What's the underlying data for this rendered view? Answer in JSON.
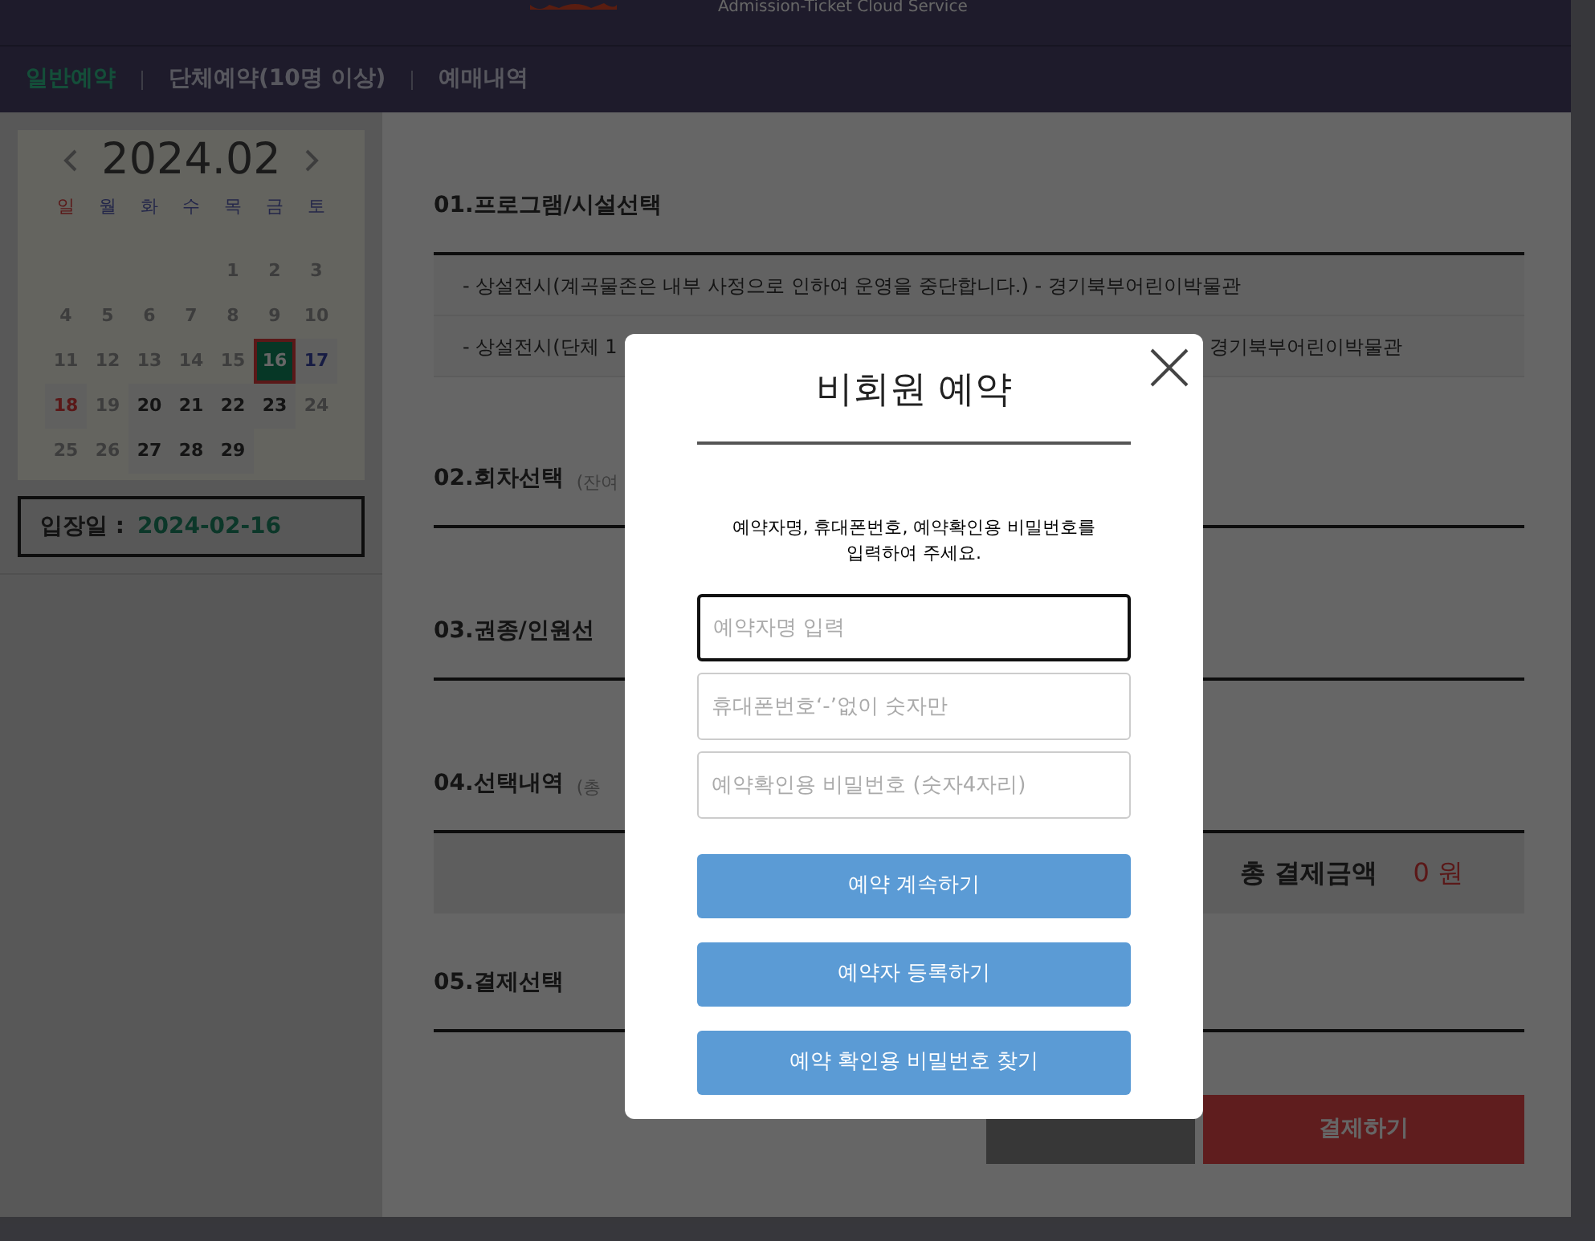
{
  "header": {
    "tagline": "Admission-Ticket Cloud Service"
  },
  "nav": [
    {
      "label": "일반예약",
      "selected": true
    },
    {
      "label": "단체예약(10명 이상)",
      "selected": false
    },
    {
      "label": "예매내역",
      "selected": false
    }
  ],
  "calendar": {
    "title": "2024.02",
    "weekdays": [
      "일",
      "월",
      "화",
      "수",
      "목",
      "금",
      "토"
    ],
    "weeks": [
      [
        {
          "day": "1",
          "available": false,
          "selected": false
        },
        {
          "day": "2",
          "available": false,
          "selected": false
        },
        {
          "day": "3",
          "available": false,
          "selected": false
        }
      ],
      [
        {
          "day": "4",
          "available": false,
          "selected": false
        },
        {
          "day": "5",
          "available": false,
          "selected": false
        },
        {
          "day": "6",
          "available": false,
          "selected": false
        },
        {
          "day": "7",
          "available": false,
          "selected": false
        },
        {
          "day": "8",
          "available": false,
          "selected": false
        },
        {
          "day": "9",
          "available": false,
          "selected": false
        },
        {
          "day": "10",
          "available": false,
          "selected": false
        }
      ],
      [
        {
          "day": "11",
          "available": false,
          "selected": false
        },
        {
          "day": "12",
          "available": false,
          "selected": false
        },
        {
          "day": "13",
          "available": false,
          "selected": false
        },
        {
          "day": "14",
          "available": false,
          "selected": false
        },
        {
          "day": "15",
          "available": false,
          "selected": false
        },
        {
          "day": "16",
          "available": true,
          "selected": true
        },
        {
          "day": "17",
          "available": true,
          "selected": false
        }
      ],
      [
        {
          "day": "18",
          "available": true,
          "selected": false
        },
        {
          "day": "19",
          "available": false,
          "selected": false
        },
        {
          "day": "20",
          "available": true,
          "selected": false
        },
        {
          "day": "21",
          "available": true,
          "selected": false
        },
        {
          "day": "22",
          "available": true,
          "selected": false
        },
        {
          "day": "23",
          "available": true,
          "selected": false
        },
        {
          "day": "24",
          "available": false,
          "selected": false
        }
      ],
      [
        {
          "day": "25",
          "available": false,
          "selected": false
        },
        {
          "day": "26",
          "available": false,
          "selected": false
        },
        {
          "day": "27",
          "available": true,
          "selected": false
        },
        {
          "day": "28",
          "available": true,
          "selected": false
        },
        {
          "day": "29",
          "available": true,
          "selected": false
        }
      ]
    ]
  },
  "entry_date": {
    "label": "입장일 :",
    "value": "2024-02-16"
  },
  "sections": [
    {
      "kind": "list",
      "title": "01.프로그램/시설선택",
      "rows": [
        {
          "text": "- 상설전시(계곡물존은 내부 사정으로 인하여 운영을 중단합니다.) - 경기북부어린이박물관"
        },
        {
          "text": "- 상설전시(단체 1",
          "trailing": "경기북부어린이박물관"
        }
      ]
    },
    {
      "kind": "plain",
      "title": "02.회차선택",
      "hint": "(잔여"
    },
    {
      "kind": "plain",
      "title": "03.권종/인원선"
    },
    {
      "kind": "total",
      "title": "04.선택내역",
      "hint": "(총",
      "total_label": "총 결제금액",
      "total_value": "0 원"
    },
    {
      "kind": "plain",
      "title": "05.결제선택"
    }
  ],
  "actions": [
    {
      "kind": "cancel"
    },
    {
      "kind": "pay",
      "label": "결제하기"
    }
  ],
  "modal": {
    "title": "비회원 예약",
    "instruction": "예약자명, 휴대폰번호, 예약확인용 비밀번호를\n입력하여 주세요.",
    "fields": [
      {
        "placeholder": "예약자명 입력",
        "focused": true
      },
      {
        "placeholder": "휴대폰번호‘-’없이 숫자만",
        "focused": false
      },
      {
        "placeholder": "예약확인용 비밀번호 (숫자4자리)",
        "focused": false
      }
    ],
    "buttons": [
      "예약 계속하기",
      "예약자 등록하기",
      "예약 확인용 비밀번호 찾기"
    ]
  }
}
